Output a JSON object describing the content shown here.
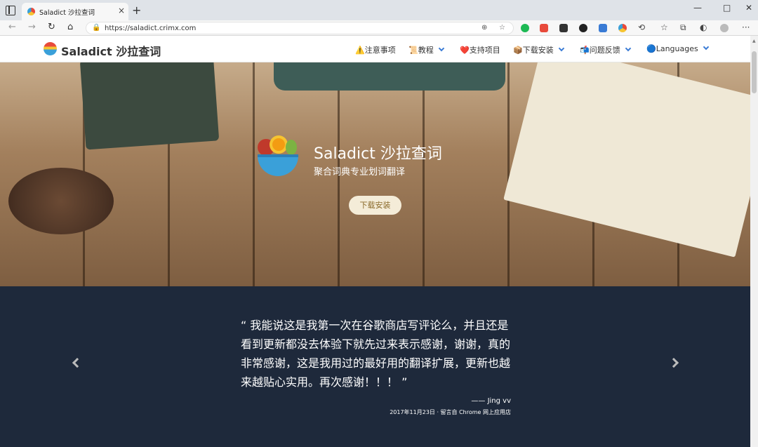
{
  "browser": {
    "tab_title": "Saladict 沙拉查词",
    "tab_close": "×",
    "new_tab": "+",
    "url": "https://saladict.crimx.com",
    "window_controls": [
      "—",
      "□",
      "✕"
    ],
    "nav_icons": {
      "back": "←",
      "forward": "→",
      "reload": "↻",
      "home": "⌂"
    }
  },
  "site": {
    "brand": "Saladict 沙拉查词",
    "nav": [
      {
        "label": "⚠️注意事项",
        "dropdown": false
      },
      {
        "label": "📜教程",
        "dropdown": true
      },
      {
        "label": "❤️支持项目",
        "dropdown": false
      },
      {
        "label": "📦下载安装",
        "dropdown": true
      },
      {
        "label": "📬问题反馈",
        "dropdown": true
      },
      {
        "label": "🔵Languages",
        "dropdown": true
      }
    ]
  },
  "hero": {
    "title": "Saladict 沙拉查词",
    "subtitle": "聚合词典专业划词翻译",
    "button": "下载安装"
  },
  "testimonial": {
    "quote": "“ 我能说这是我第一次在谷歌商店写评论么，并且还是看到更新都没去体验下就先过来表示感谢，谢谢，真的非常感谢，这是我用过的最好用的翻译扩展，更新也越来越贴心实用。再次感谢！！！ ”",
    "author": "—— Jing vv",
    "meta": "2017年11月23日 · 留言自 Chrome 网上应用店"
  },
  "colors": {
    "testimonial_bg": "#1e293b",
    "chevron": "#3a7bd5",
    "button_bg": "#f4ecd8"
  }
}
